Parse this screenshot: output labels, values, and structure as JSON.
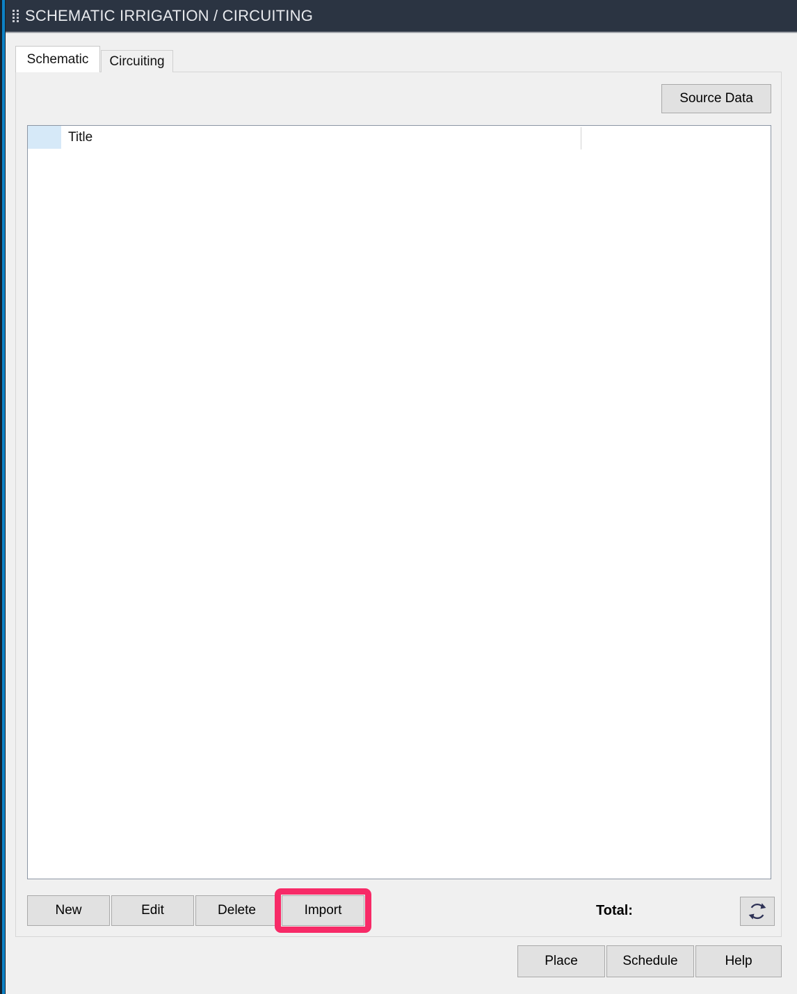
{
  "window": {
    "title": "SCHEMATIC IRRIGATION / CIRCUITING",
    "drag_handle_icon": "drag-dots-icon"
  },
  "tabs": [
    {
      "label": "Schematic",
      "active": true
    },
    {
      "label": "Circuiting",
      "active": false
    }
  ],
  "toolbar": {
    "source_data_label": "Source Data"
  },
  "grid": {
    "columns": [
      "",
      "Title",
      ""
    ],
    "title_header": "Title",
    "rows": [],
    "select_cell_color": "#d6e9f8"
  },
  "actions": {
    "new_label": "New",
    "edit_label": "Edit",
    "delete_label": "Delete",
    "import_label": "Import",
    "total_label": "Total:",
    "total_value": "",
    "refresh_icon": "refresh-icon",
    "highlight_color": "#f72a67",
    "highlighted_button": "Import"
  },
  "footer": {
    "place_label": "Place",
    "schedule_label": "Schedule",
    "help_label": "Help"
  },
  "theme": {
    "titlebar_color": "#2b3442",
    "accent_rail_color": "#0d82c6",
    "accent_rail_dark": "#13212e",
    "button_face": "#e1e1e1",
    "panel_background": "#f0f0f0",
    "icon_navy": "#2e3256"
  }
}
